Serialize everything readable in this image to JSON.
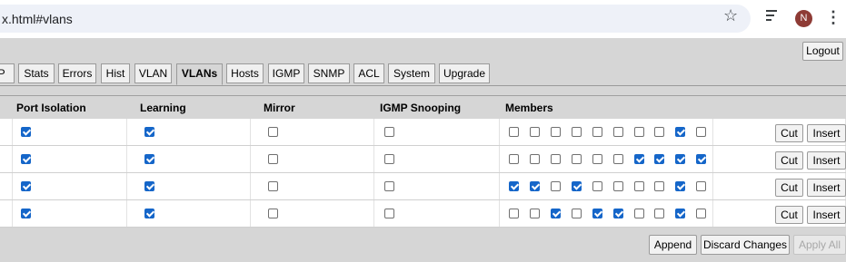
{
  "browser": {
    "url": "x.html#vlans",
    "avatar_initial": "N"
  },
  "app": {
    "logout_label": "Logout",
    "tabs": [
      {
        "label": "TP",
        "active": false
      },
      {
        "label": "Stats",
        "active": false
      },
      {
        "label": "Errors",
        "active": false
      },
      {
        "label": "Hist",
        "active": false
      },
      {
        "label": "VLAN",
        "active": false
      },
      {
        "label": "VLANs",
        "active": true
      },
      {
        "label": "Hosts",
        "active": false
      },
      {
        "label": "IGMP",
        "active": false
      },
      {
        "label": "SNMP",
        "active": false
      },
      {
        "label": "ACL",
        "active": false
      },
      {
        "label": "System",
        "active": false
      },
      {
        "label": "Upgrade",
        "active": false
      }
    ],
    "table": {
      "headers": {
        "port_isolation": "Port Isolation",
        "learning": "Learning",
        "mirror": "Mirror",
        "igmp_snooping": "IGMP Snooping",
        "members": "Members"
      },
      "rows": [
        {
          "port_isolation": true,
          "learning": true,
          "mirror": false,
          "igmp_snooping": false,
          "members": [
            false,
            false,
            false,
            false,
            false,
            false,
            false,
            false,
            true,
            false
          ]
        },
        {
          "port_isolation": true,
          "learning": true,
          "mirror": false,
          "igmp_snooping": false,
          "members": [
            false,
            false,
            false,
            false,
            false,
            false,
            true,
            true,
            true,
            true
          ]
        },
        {
          "port_isolation": true,
          "learning": true,
          "mirror": false,
          "igmp_snooping": false,
          "members": [
            true,
            true,
            false,
            true,
            false,
            false,
            false,
            false,
            true,
            false
          ]
        },
        {
          "port_isolation": true,
          "learning": true,
          "mirror": false,
          "igmp_snooping": false,
          "members": [
            false,
            false,
            true,
            false,
            true,
            true,
            false,
            false,
            true,
            false
          ]
        }
      ],
      "cut_label": "Cut",
      "insert_label": "Insert"
    },
    "footer": {
      "append_label": "Append",
      "discard_label": "Discard Changes",
      "apply_label": "Apply All",
      "apply_disabled": true
    }
  },
  "colors": {
    "checkbox_checked": "#1566c9",
    "panel_bg": "#d6d6d6"
  }
}
